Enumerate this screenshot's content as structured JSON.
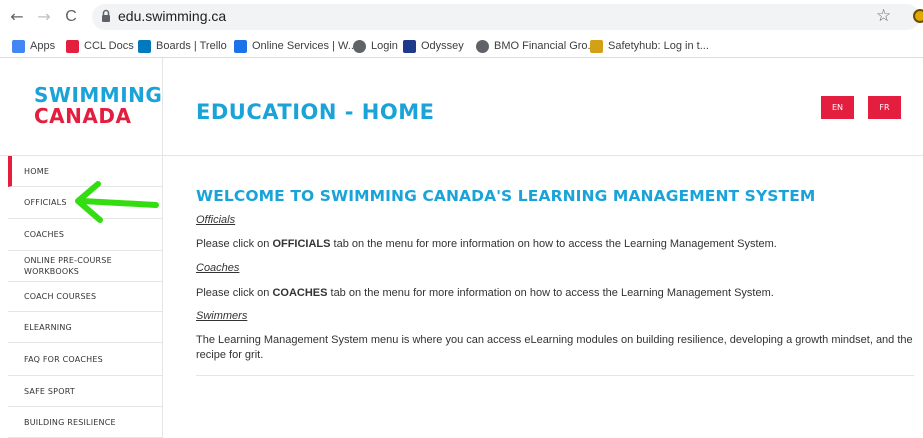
{
  "browser": {
    "back_glyph": "←",
    "forward_glyph": "→",
    "reload_glyph": "C",
    "url_host": "edu.swimming.ca",
    "star_glyph": "☆",
    "bookmarks": [
      {
        "label": "Apps",
        "color": "#4285f4",
        "icon": "apps-grid-icon"
      },
      {
        "label": "CCL Docs",
        "color": "#e41e3f",
        "icon": "shield-icon"
      },
      {
        "label": "Boards | Trello",
        "color": "#0079bf",
        "icon": "trello-icon"
      },
      {
        "label": "Online Services | W...",
        "color": "#1a73e8",
        "icon": "binoculars-icon"
      },
      {
        "label": "Login",
        "color": "#5f6368",
        "icon": "globe-icon"
      },
      {
        "label": "Odyssey",
        "color": "#1e3a8a",
        "icon": "odyssey-icon"
      },
      {
        "label": "BMO Financial Gro...",
        "color": "#5f6368",
        "icon": "globe-icon"
      },
      {
        "label": "Safetyhub: Log in t...",
        "color": "#d4a017",
        "icon": "folder-icon"
      }
    ]
  },
  "site": {
    "logo_line1": "SWIMMING",
    "logo_line2": "CANADA",
    "page_title": "EDUCATION - HOME",
    "lang_en": "EN",
    "lang_fr": "FR",
    "colors": {
      "blue": "#1aa3d8",
      "red": "#e41e3f"
    }
  },
  "sidebar": {
    "items": [
      {
        "label": "HOME",
        "active": true
      },
      {
        "label": "OFFICIALS"
      },
      {
        "label": "COACHES"
      },
      {
        "label": "ONLINE PRE-COURSE",
        "label2": "WORKBOOKS"
      },
      {
        "label": "COACH COURSES"
      },
      {
        "label": "ELEARNING"
      },
      {
        "label": "FAQ FOR COACHES"
      },
      {
        "label": "SAFE SPORT"
      },
      {
        "label": "BUILDING RESILIENCE"
      }
    ]
  },
  "content": {
    "heading": "WELCOME TO SWIMMING CANADA'S LEARNING MANAGEMENT SYSTEM",
    "officials_sub": "Officials",
    "officials_pre": "Please click on ",
    "officials_bold": "OFFICIALS",
    "officials_post": " tab on the menu for more information on how to access the Learning Management System.",
    "coaches_sub": "Coaches",
    "coaches_pre": "Please click on ",
    "coaches_bold": "COACHES",
    "coaches_post": " tab on the menu for more information on how to access the Learning Management System.",
    "swimmers_sub": "Swimmers",
    "swimmers_text_1": "The Learning Management System menu is where you can access eLearning modules on building resilience, developing a growth mindset, and the",
    "swimmers_text_2": "recipe for grit."
  },
  "annotation": {
    "arrow_color": "#33dd11"
  }
}
